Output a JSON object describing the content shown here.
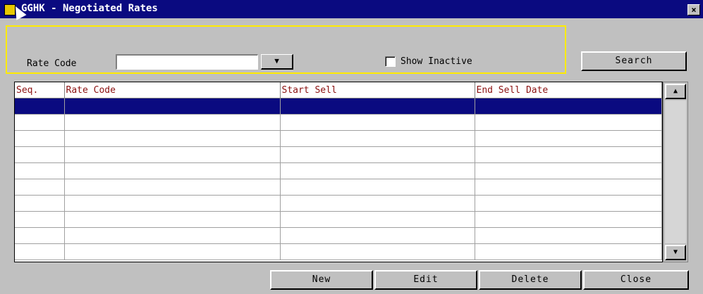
{
  "window": {
    "title": "GGHK - Negotiated Rates",
    "close_label": "×"
  },
  "criteria": {
    "rate_code_label": "Rate Code",
    "rate_code_value": "",
    "show_inactive_label": "Show Inactive",
    "show_inactive_checked": false,
    "search_label": "Search"
  },
  "grid": {
    "columns": [
      "Seq.",
      "Rate Code",
      "Start Sell",
      "End Sell Date"
    ],
    "selected_row": 0,
    "row_count": 10
  },
  "buttons": {
    "new": "New",
    "edit": "Edit",
    "delete": "Delete",
    "close": "Close"
  },
  "colors": {
    "title_bar": "#0a0a80",
    "header_text": "#8b1010",
    "criteria_border": "#ffeb00",
    "selection": "#0a0a80"
  }
}
